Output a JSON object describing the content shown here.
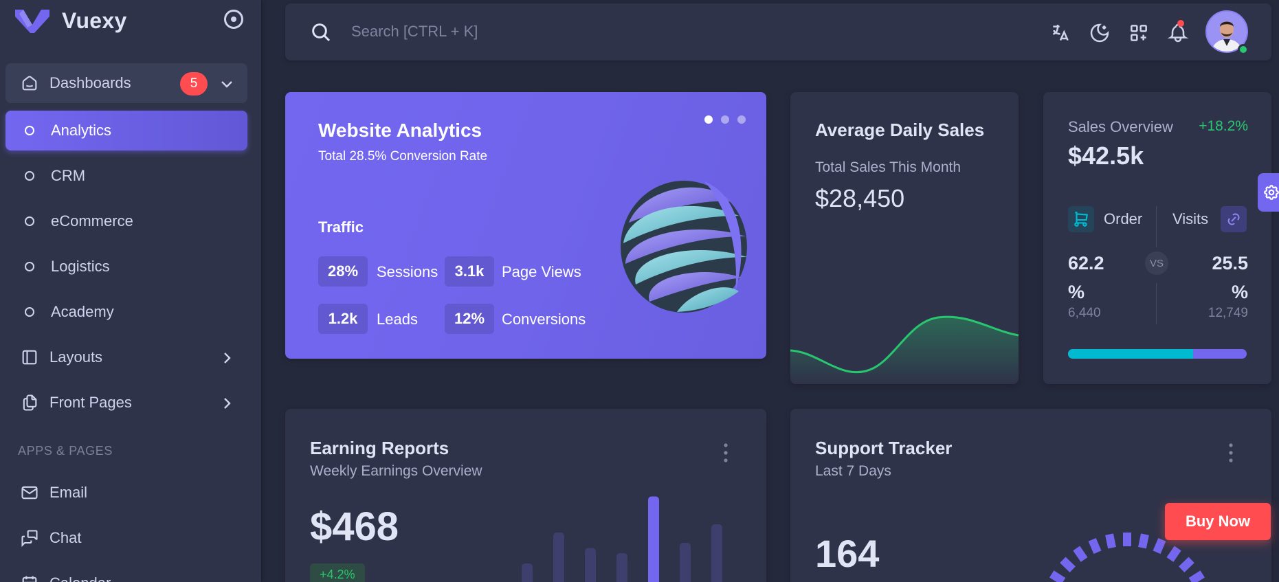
{
  "brand": {
    "name": "Vuexy"
  },
  "sidebar": {
    "items": [
      {
        "label": "Dashboards",
        "icon": "smart-home-icon",
        "badge": "5"
      },
      {
        "label": "Analytics"
      },
      {
        "label": "CRM"
      },
      {
        "label": "eCommerce"
      },
      {
        "label": "Logistics"
      },
      {
        "label": "Academy"
      },
      {
        "label": "Layouts",
        "icon": "layout-sidebar-icon"
      },
      {
        "label": "Front Pages",
        "icon": "files-icon"
      }
    ],
    "section": "APPS & PAGES",
    "apps": [
      {
        "label": "Email",
        "icon": "mail-icon"
      },
      {
        "label": "Chat",
        "icon": "messages-icon"
      },
      {
        "label": "Calendar",
        "icon": "calendar-icon"
      }
    ]
  },
  "search": {
    "placeholder": "Search [CTRL + K]"
  },
  "website_analytics": {
    "title": "Website Analytics",
    "subtitle": "Total 28.5% Conversion Rate",
    "traffic_label": "Traffic",
    "stats": [
      {
        "value": "28%",
        "label": "Sessions"
      },
      {
        "value": "3.1k",
        "label": "Page Views"
      },
      {
        "value": "1.2k",
        "label": "Leads"
      },
      {
        "value": "12%",
        "label": "Conversions"
      }
    ]
  },
  "avg_daily_sales": {
    "title": "Average Daily Sales",
    "subtitle": "Total Sales This Month",
    "value": "$28,450",
    "line_color": "#28c76f"
  },
  "sales_overview": {
    "title": "Sales Overview",
    "change": "+18.2%",
    "value": "$42.5k",
    "order": {
      "label": "Order",
      "percent": "62.2",
      "unit": "%",
      "count": "6,440"
    },
    "visits": {
      "label": "Visits",
      "percent": "25.5",
      "unit": "%",
      "count": "12,749"
    },
    "vs": "VS",
    "order_share": 0.7
  },
  "earning_reports": {
    "title": "Earning Reports",
    "subtitle": "Weekly Earnings Overview",
    "value": "$468",
    "change": "+4.2%",
    "bar_levels": [
      0.3,
      0.6,
      0.45,
      0.4,
      0.95,
      0.5,
      0.68
    ]
  },
  "support_tracker": {
    "title": "Support Tracker",
    "subtitle": "Last 7 Days",
    "value": "164"
  },
  "buy_now": {
    "label": "Buy Now"
  },
  "colors": {
    "primary": "#7367f0",
    "success": "#28c76f",
    "danger": "#ff4c51",
    "info": "#00bad1"
  }
}
